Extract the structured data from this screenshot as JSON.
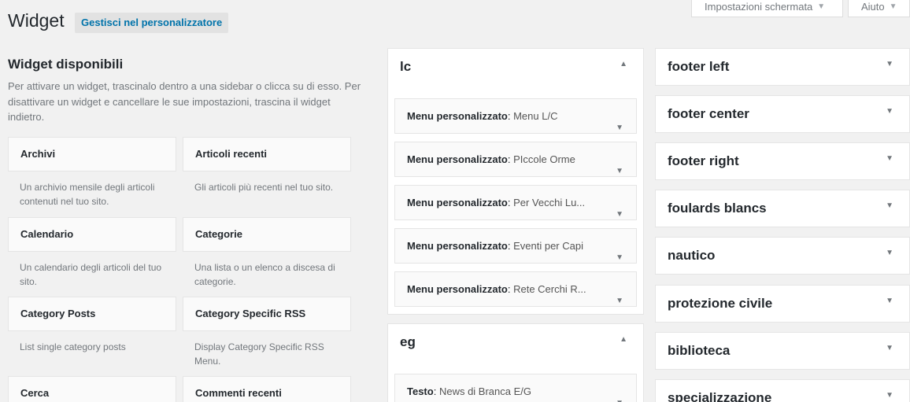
{
  "header": {
    "title": "Widget",
    "customizer_label": "Gestisci nel personalizzatore",
    "screen_options_label": "Impostazioni schermata",
    "help_label": "Aiuto"
  },
  "available": {
    "title": "Widget disponibili",
    "description": "Per attivare un widget, trascinalo dentro a una sidebar o clicca su di esso. Per disattivare un widget e cancellare le sue impostazioni, trascina il widget indietro.",
    "widgets": [
      {
        "name": "Archivi",
        "desc": "Un archivio mensile degli articoli contenuti nel tuo sito."
      },
      {
        "name": "Articoli recenti",
        "desc": "Gli articoli più recenti nel tuo sito."
      },
      {
        "name": "Calendario",
        "desc": "Un calendario degli articoli del tuo sito."
      },
      {
        "name": "Categorie",
        "desc": "Una lista o un elenco a discesa di categorie."
      },
      {
        "name": "Category Posts",
        "desc": "List single category posts"
      },
      {
        "name": "Category Specific RSS",
        "desc": "Display Category Specific RSS Menu."
      },
      {
        "name": "Cerca",
        "desc": ""
      },
      {
        "name": "Commenti recenti",
        "desc": ""
      }
    ]
  },
  "sidebars_middle": [
    {
      "title": "lc",
      "widgets": [
        {
          "type": "Menu personalizzato",
          "name": "Menu L/C"
        },
        {
          "type": "Menu personalizzato",
          "name": "PIccole Orme"
        },
        {
          "type": "Menu personalizzato",
          "name": "Per Vecchi Lu..."
        },
        {
          "type": "Menu personalizzato",
          "name": "Eventi per Capi"
        },
        {
          "type": "Menu personalizzato",
          "name": "Rete Cerchi R..."
        }
      ]
    },
    {
      "title": "eg",
      "widgets": [
        {
          "type": "Testo",
          "name": "News di Branca E/G"
        }
      ]
    }
  ],
  "sidebars_right": [
    {
      "title": "footer left"
    },
    {
      "title": "footer center"
    },
    {
      "title": "footer right"
    },
    {
      "title": "foulards blancs"
    },
    {
      "title": "nautico"
    },
    {
      "title": "protezione civile"
    },
    {
      "title": "biblioteca"
    },
    {
      "title": "specializzazione"
    }
  ],
  "colors": {
    "accent": "#0073aa",
    "background": "#f1f1f1"
  }
}
